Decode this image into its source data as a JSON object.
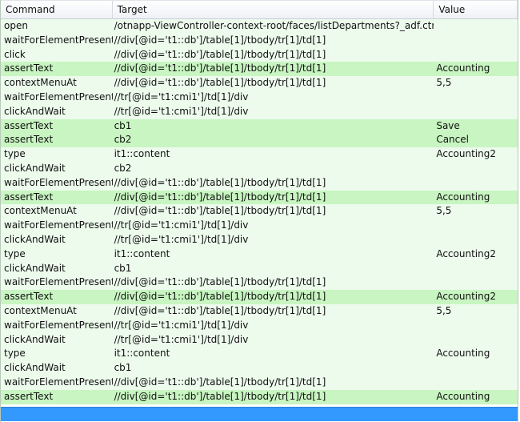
{
  "header": {
    "command": "Command",
    "target": "Target",
    "value": "Value"
  },
  "rows": [
    {
      "command": "open",
      "target": "/otnapp-ViewController-context-root/faces/listDepartments?_adf.ctrl-stat...",
      "value": "",
      "highlight": false
    },
    {
      "command": "waitForElementPresent",
      "target": "//div[@id='t1::db']/table[1]/tbody/tr[1]/td[1]",
      "value": "",
      "highlight": false
    },
    {
      "command": "click",
      "target": "//div[@id='t1::db']/table[1]/tbody/tr[1]/td[1]",
      "value": "",
      "highlight": false
    },
    {
      "command": "assertText",
      "target": "//div[@id='t1::db']/table[1]/tbody/tr[1]/td[1]",
      "value": "Accounting",
      "highlight": true
    },
    {
      "command": "contextMenuAt",
      "target": "//div[@id='t1::db']/table[1]/tbody/tr[1]/td[1]",
      "value": "5,5",
      "highlight": false
    },
    {
      "command": "waitForElementPresent",
      "target": "//tr[@id='t1:cmi1']/td[1]/div",
      "value": "",
      "highlight": false
    },
    {
      "command": "clickAndWait",
      "target": "//tr[@id='t1:cmi1']/td[1]/div",
      "value": "",
      "highlight": false
    },
    {
      "command": "assertText",
      "target": "cb1",
      "value": "Save",
      "highlight": true
    },
    {
      "command": "assertText",
      "target": "cb2",
      "value": "Cancel",
      "highlight": true
    },
    {
      "command": "type",
      "target": "it1::content",
      "value": "Accounting2",
      "highlight": false
    },
    {
      "command": "clickAndWait",
      "target": "cb2",
      "value": "",
      "highlight": false
    },
    {
      "command": "waitForElementPresent",
      "target": "//div[@id='t1::db']/table[1]/tbody/tr[1]/td[1]",
      "value": "",
      "highlight": false
    },
    {
      "command": "assertText",
      "target": "//div[@id='t1::db']/table[1]/tbody/tr[1]/td[1]",
      "value": "Accounting",
      "highlight": true
    },
    {
      "command": "contextMenuAt",
      "target": "//div[@id='t1::db']/table[1]/tbody/tr[1]/td[1]",
      "value": "5,5",
      "highlight": false
    },
    {
      "command": "waitForElementPresent",
      "target": "//tr[@id='t1:cmi1']/td[1]/div",
      "value": "",
      "highlight": false
    },
    {
      "command": "clickAndWait",
      "target": "//tr[@id='t1:cmi1']/td[1]/div",
      "value": "",
      "highlight": false
    },
    {
      "command": "type",
      "target": "it1::content",
      "value": "Accounting2",
      "highlight": false
    },
    {
      "command": "clickAndWait",
      "target": "cb1",
      "value": "",
      "highlight": false
    },
    {
      "command": "waitForElementPresent",
      "target": "//div[@id='t1::db']/table[1]/tbody/tr[1]/td[1]",
      "value": "",
      "highlight": false
    },
    {
      "command": "assertText",
      "target": "//div[@id='t1::db']/table[1]/tbody/tr[1]/td[1]",
      "value": "Accounting2",
      "highlight": true
    },
    {
      "command": "contextMenuAt",
      "target": "//div[@id='t1::db']/table[1]/tbody/tr[1]/td[1]",
      "value": "5,5",
      "highlight": false
    },
    {
      "command": "waitForElementPresent",
      "target": "//tr[@id='t1:cmi1']/td[1]/div",
      "value": "",
      "highlight": false
    },
    {
      "command": "clickAndWait",
      "target": "//tr[@id='t1:cmi1']/td[1]/div",
      "value": "",
      "highlight": false
    },
    {
      "command": "type",
      "target": "it1::content",
      "value": "Accounting",
      "highlight": false
    },
    {
      "command": "clickAndWait",
      "target": "cb1",
      "value": "",
      "highlight": false
    },
    {
      "command": "waitForElementPresent",
      "target": "//div[@id='t1::db']/table[1]/tbody/tr[1]/td[1]",
      "value": "",
      "highlight": false
    },
    {
      "command": "assertText",
      "target": "//div[@id='t1::db']/table[1]/tbody/tr[1]/td[1]",
      "value": "Accounting",
      "highlight": true
    }
  ],
  "colors": {
    "row_bg": "#edfbed",
    "highlight_bg": "#c8f5c1",
    "selection": "#3399ff"
  }
}
